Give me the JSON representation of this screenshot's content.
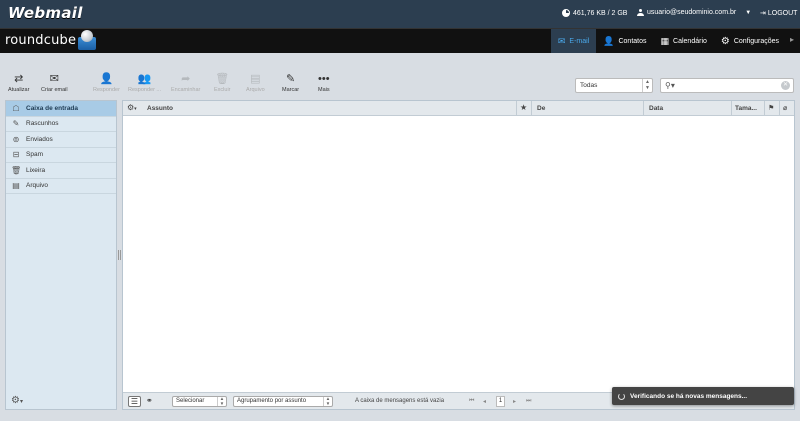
{
  "top": {
    "brand": "Webmail",
    "quota": "461,76 KB / 2 GB",
    "user": "usuario@seudominio.com.br",
    "logout": "LOGOUT"
  },
  "nav": {
    "logo": "roundcube",
    "tabs": [
      {
        "label": "E-mail",
        "icon": "envelope-icon"
      },
      {
        "label": "Contatos",
        "icon": "contacts-icon"
      },
      {
        "label": "Calendário",
        "icon": "calendar-icon"
      },
      {
        "label": "Configurações",
        "icon": "gear-icon"
      }
    ]
  },
  "toolbar": {
    "refresh": "Atualizar",
    "compose": "Criar email",
    "reply": "Responder",
    "reply_all": "Responder ...",
    "forward": "Encaminhar",
    "delete": "Excluir",
    "archive": "Arquivo",
    "mark": "Marcar",
    "more": "Mais",
    "filter": "Todas",
    "search_placeholder": ""
  },
  "folders": [
    {
      "label": "Caixa de entrada",
      "icon": "inbox-icon"
    },
    {
      "label": "Rascunhos",
      "icon": "pencil-icon"
    },
    {
      "label": "Enviados",
      "icon": "sent-icon"
    },
    {
      "label": "Spam",
      "icon": "spam-icon"
    },
    {
      "label": "Lixeira",
      "icon": "trash-icon"
    },
    {
      "label": "Arquivo",
      "icon": "archive-icon"
    }
  ],
  "list": {
    "columns": {
      "subject": "Assunto",
      "from": "De",
      "date": "Data",
      "size": "Tama..."
    },
    "select": "Selecionar",
    "threads": "Agrupamento por assunto",
    "empty": "A caixa de mensagens está vazia",
    "page": "1"
  },
  "notice": "Verificando se há novas mensagens...",
  "colors": {
    "topbar": "#2c3e50",
    "accent": "#4aa8ea",
    "active_folder": "#a8cbe6"
  }
}
